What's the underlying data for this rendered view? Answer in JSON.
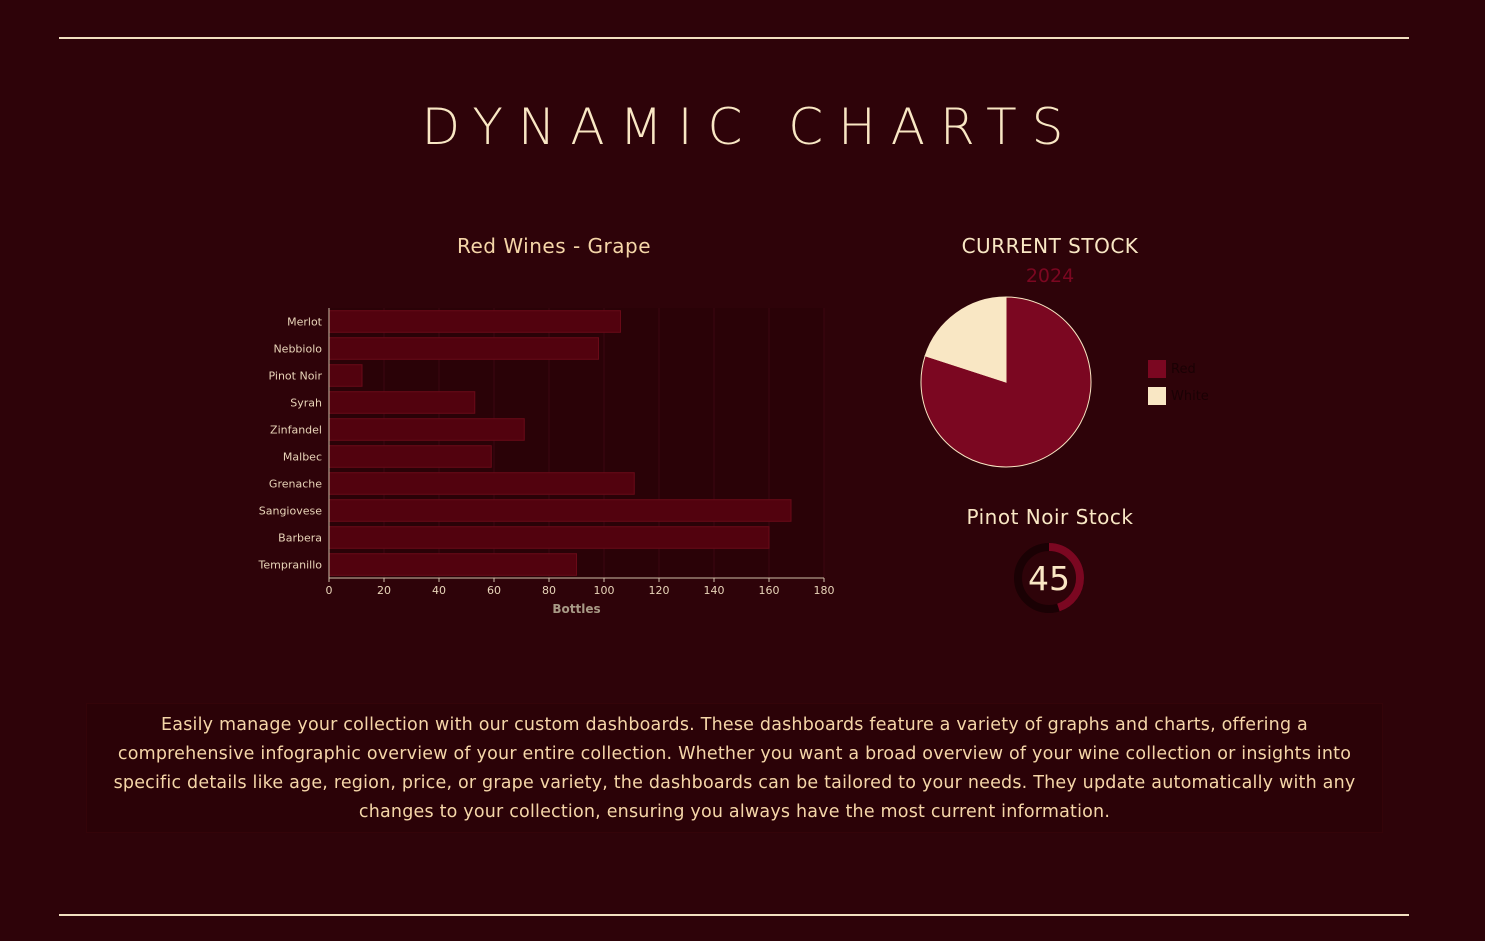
{
  "page": {
    "title": "DYNAMIC CHARTS",
    "description": "Easily manage your collection with our custom dashboards. These dashboards feature a variety of graphs and charts, offering a comprehensive infographic overview of your entire collection. Whether you want a broad overview of your wine collection or insights into specific details like age, region, price, or grape variety, the dashboards can be tailored to your needs. They update automatically with any changes to your collection, ensuring you always have the most current information."
  },
  "colors": {
    "background": "#2e0309",
    "cream": "#f9e7c4",
    "wine": "#7b0721",
    "bar": "#52020e",
    "bar_stroke": "#6a0a18"
  },
  "chart_data": [
    {
      "type": "bar",
      "orientation": "horizontal",
      "title": "Red Wines - Grape",
      "xlabel": "Bottles",
      "ylabel": "",
      "categories": [
        "Merlot",
        "Nebbiolo",
        "Pinot Noir",
        "Syrah",
        "Zinfandel",
        "Malbec",
        "Grenache",
        "Sangiovese",
        "Barbera",
        "Tempranillo"
      ],
      "values": [
        106,
        98,
        12,
        53,
        71,
        59,
        111,
        168,
        160,
        90
      ],
      "xlim": [
        0,
        180
      ],
      "xticks": [
        "0",
        "20",
        "40",
        "60",
        "80",
        "100",
        "120",
        "140",
        "160",
        "180"
      ],
      "grid": true
    },
    {
      "type": "pie",
      "title": "CURRENT STOCK",
      "subtitle": "2024",
      "categories": [
        "Red",
        "White"
      ],
      "values": [
        80,
        20
      ],
      "colors": [
        "#7b0721",
        "#f9e7c4"
      ],
      "legend": "right"
    },
    {
      "type": "gauge",
      "title": "Pinot Noir Stock",
      "value": 45,
      "fraction": 0.45,
      "colors": [
        "#7b0721",
        "#1a0104"
      ]
    }
  ]
}
